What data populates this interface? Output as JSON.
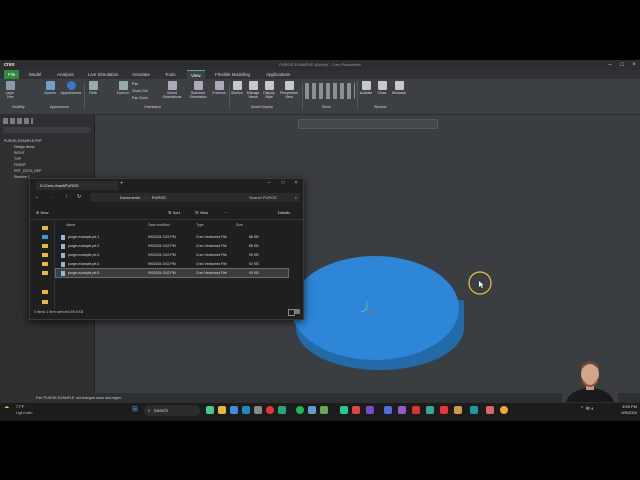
{
  "window": {
    "logo": "creo",
    "title": "PURGE-EXAMPLE (Active) - Creo Parametric"
  },
  "ribbon_tabs": [
    "File",
    "Model",
    "Analysis",
    "Live Simulation",
    "Annotate",
    "Tools",
    "View",
    "Flexible Modeling",
    "Applications"
  ],
  "ribbon": {
    "buttons": [
      "Layer Tree",
      "Scenes",
      "Appearances",
      "Refit",
      "Zoom In",
      "Saved Orientations",
      "Standard Orientation",
      "Previous",
      "Section",
      "Manage Views",
      "Display Style",
      "Perspective View",
      "Activate",
      "Close",
      "Windows"
    ],
    "pan_items": [
      "Pan",
      "Zoom Out",
      "Pan Zoom"
    ],
    "groups": [
      "Visibility",
      "Appearance",
      "Orientation",
      "Model Display",
      "Show",
      "Window"
    ]
  },
  "tree": {
    "items": [
      "PURGE-EXAMPLE.PRT",
      "Design Items",
      "RIGHT",
      "TOP",
      "FRONT",
      "PRT_CSYS_DEF",
      "Revolve 1"
    ]
  },
  "explorer": {
    "tab_title": "D:\\Creo-\\hwd\\PURGE",
    "breadcrumb": [
      "Documents",
      "PURGE"
    ],
    "search_placeholder": "Search PURGE",
    "new_label": "New",
    "sort_label": "Sort",
    "view_label": "View",
    "details_label": "Details",
    "columns": [
      "Name",
      "Date modified",
      "Type",
      "Size"
    ],
    "files": [
      {
        "name": "purge-example.prt.1",
        "date": "9/9/2024 3:52 PM",
        "type": "Creo Versioned File",
        "size": "88 KB"
      },
      {
        "name": "purge-example.prt.2",
        "date": "9/9/2024 3:52 PM",
        "type": "Creo Versioned File",
        "size": "88 KB"
      },
      {
        "name": "purge-example.prt.3",
        "date": "9/9/2024 3:52 PM",
        "type": "Creo Versioned File",
        "size": "90 KB"
      },
      {
        "name": "purge-example.prt.4",
        "date": "9/9/2024 3:52 PM",
        "type": "Creo Versioned File",
        "size": "92 KB"
      },
      {
        "name": "purge-example.prt.5",
        "date": "9/9/2024 3:52 PM",
        "type": "Creo Versioned File",
        "size": "93 KB"
      }
    ],
    "selected_index": 4,
    "status": "5 items   1 item selected 89.8 KB"
  },
  "status_bar": {
    "message": "Part 'PURGE-EXAMPLE' not changed since last regen."
  },
  "taskbar": {
    "weather_temp": "77°F",
    "weather_desc": "Light rain",
    "search_label": "Search",
    "time": "3:59 PM",
    "date": "9/9/2024"
  },
  "colors": {
    "disk": "#2e86d8",
    "cursor_ring": "#e8c640",
    "file_tab": "#2e8b3c"
  }
}
